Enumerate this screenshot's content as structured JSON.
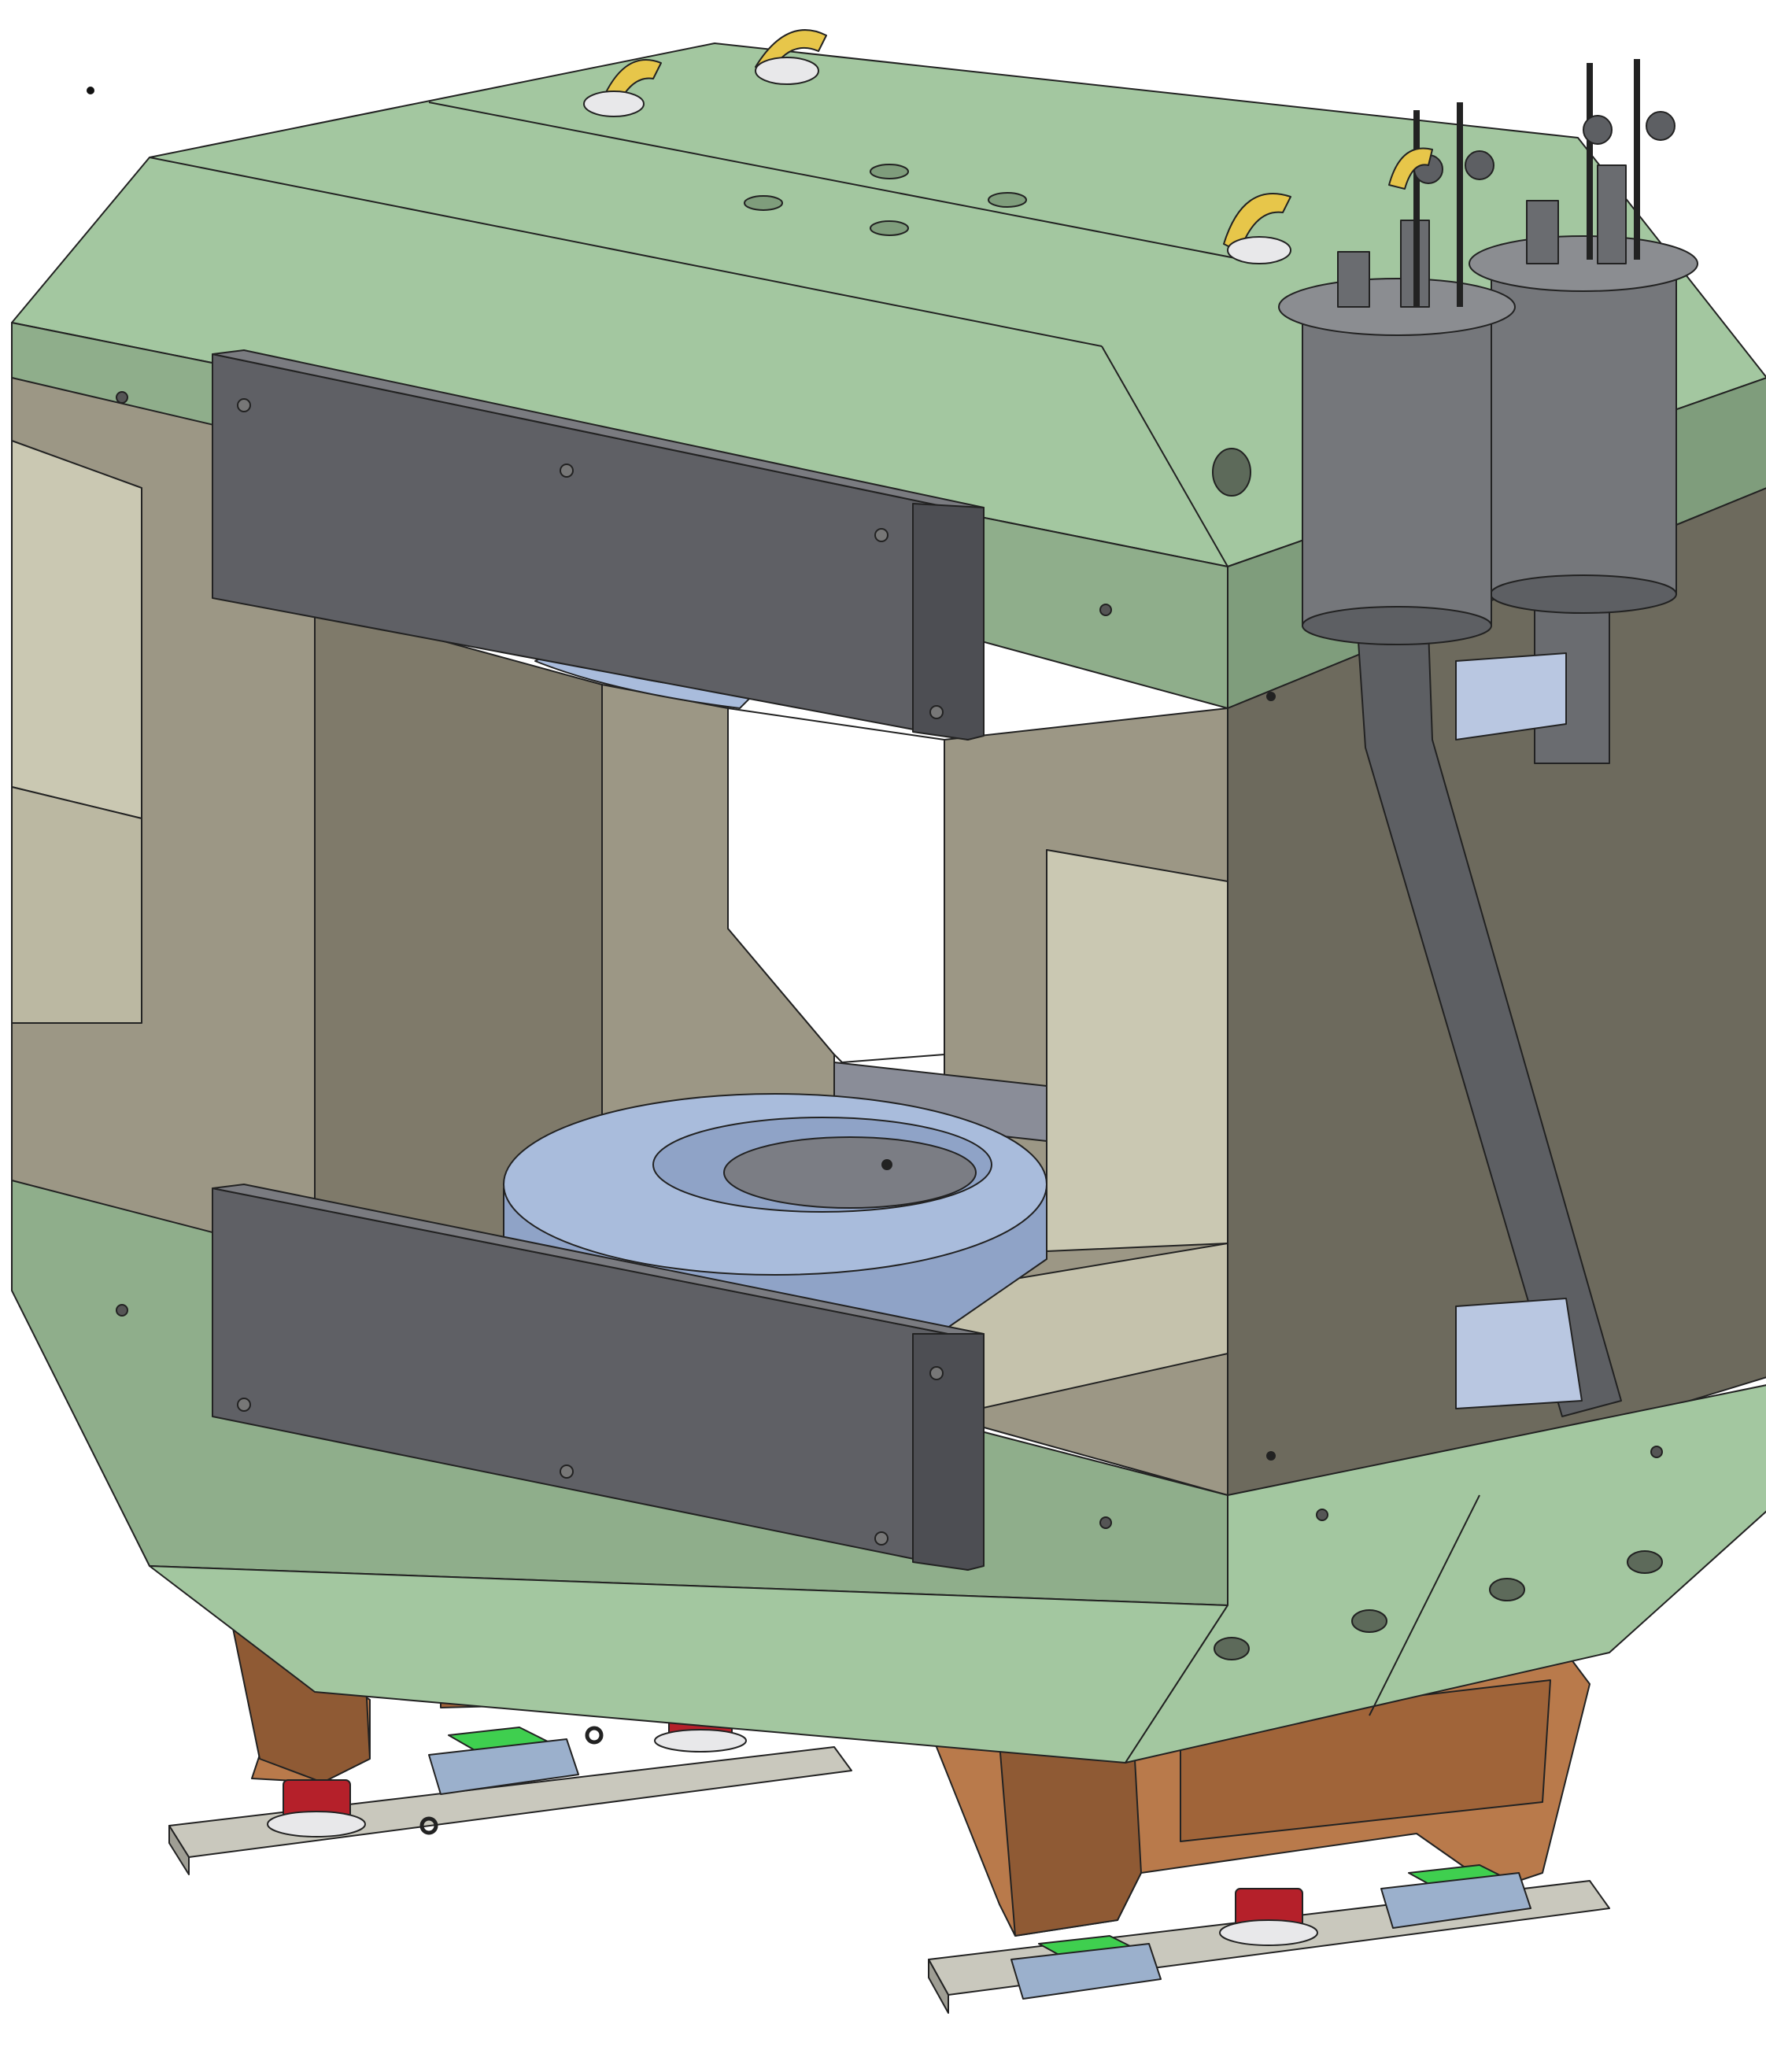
{
  "scene": {
    "subject": "magnet-yoke-assembly",
    "view": "isometric-cad-render",
    "text_labels": []
  },
  "colors": {
    "background": "#ffffff",
    "yoke_green_light": "#a3c7a0",
    "yoke_green_mid": "#8fae8b",
    "yoke_green_dark": "#7f9d7c",
    "yoke_tan_light": "#cac8b2",
    "yoke_tan_mid": "#9c9785",
    "yoke_tan_dark": "#7f7a6a",
    "yoke_shadow": "#6d6a5d",
    "coil_gray": "#5f6065",
    "coil_gray_dark": "#4d4e53",
    "pole_blue": "#8fa3c7",
    "pole_blue_light": "#a9bcdc",
    "pole_gray": "#7b7d84",
    "cryostat_gray": "#75777b",
    "cryostat_dark": "#5d5f63",
    "support_copper": "#b97a4b",
    "support_copper_dark": "#8f5a34",
    "plate_gray": "#c9c8bd",
    "jack_red": "#b5202a",
    "pad_green": "#3fcf4f",
    "jack_blue": "#9bb0cc",
    "lifting_eye_yellow": "#e7c64a",
    "outline": "#222222"
  },
  "components": {
    "lifting_eyes": 4,
    "cryostats": 2,
    "coils": 2,
    "support_frames": 2,
    "base_plates": 2
  }
}
